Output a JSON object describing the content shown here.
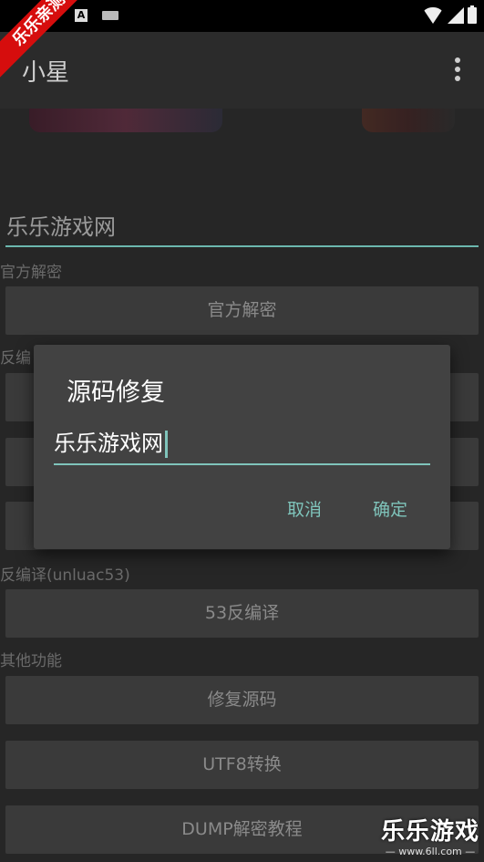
{
  "status_bar": {
    "a_icon": "A"
  },
  "badge": {
    "text": "乐乐亲测"
  },
  "appbar": {
    "title": "小星"
  },
  "main_input": {
    "value": "乐乐游戏网"
  },
  "sections": {
    "official": {
      "label": "官方解密",
      "button": "官方解密"
    },
    "decompile": {
      "label": "反编"
    },
    "unluac53": {
      "label": "反编译(unluac53)",
      "button": "53反编译"
    },
    "other": {
      "label": "其他功能",
      "buttons": [
        "修复源码",
        "UTF8转换",
        "DUMP解密教程"
      ]
    }
  },
  "dialog": {
    "title": "源码修复",
    "input_value": "乐乐游戏网",
    "cancel": "取消",
    "ok": "确定",
    "accent": "#7fc4bb"
  },
  "watermark": {
    "main": "乐乐游戏",
    "sub": "— www.6ll.com —"
  }
}
